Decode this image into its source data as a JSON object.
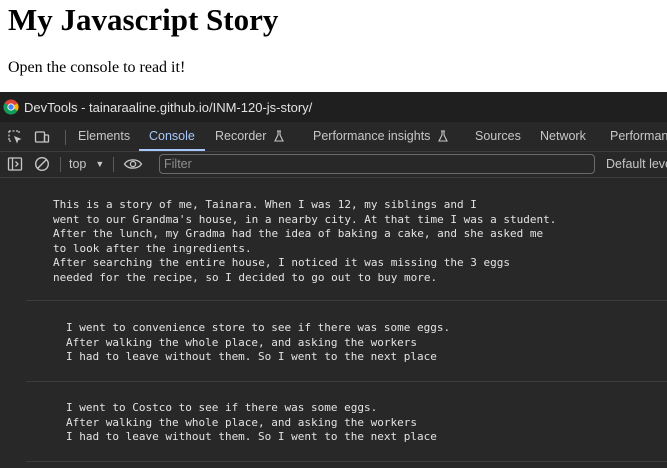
{
  "page": {
    "heading": "My Javascript Story",
    "paragraph": "Open the console to read it!"
  },
  "devtools": {
    "window_title": "DevTools - tainaraaline.github.io/INM-120-js-story/",
    "tabs": [
      {
        "label": "Elements"
      },
      {
        "label": "Console",
        "active": true
      },
      {
        "label": "Recorder",
        "icon": "flask-icon"
      },
      {
        "label": "Performance insights",
        "icon": "flask-icon"
      },
      {
        "label": "Sources"
      },
      {
        "label": "Network"
      },
      {
        "label": "Performance"
      }
    ],
    "toolbar": {
      "context": "top",
      "filter_placeholder": "Filter",
      "levels": "Default levels"
    },
    "console_messages": [
      {
        "text": "This is a story of me, Tainara. When I was 12, my siblings and I\nwent to our Grandma's house, in a nearby city. At that time I was a student.\nAfter the lunch, my Gradma had the idea of baking a cake, and she asked me\nto look after the ingredients.\nAfter searching the entire house, I noticed it was missing the 3 eggs\nneeded for the recipe, so I decided to go out to buy more."
      },
      {
        "text": "I went to convenience store to see if there was some eggs.\nAfter walking the whole place, and asking the workers\nI had to leave without them. So I went to the next place"
      },
      {
        "text": "I went to Costco to see if there was some eggs.\nAfter walking the whole place, and asking the workers\nI had to leave without them. So I went to the next place"
      }
    ]
  },
  "colors": {
    "active_tab": "#a8c7fa",
    "panel_bg": "#282828",
    "titlebar_bg": "#1f1f1f"
  }
}
